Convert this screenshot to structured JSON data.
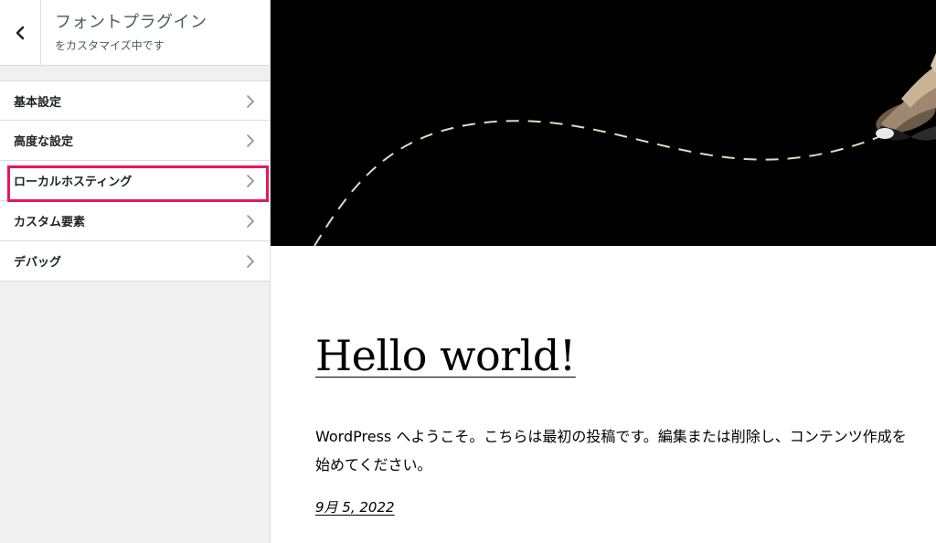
{
  "sidebar": {
    "header": {
      "title": "フォントプラグイン",
      "subtitle": "をカスタマイズ中です"
    },
    "items": [
      {
        "label": "基本設定"
      },
      {
        "label": "高度な設定"
      },
      {
        "label": "ローカルホスティング",
        "highlighted": true
      },
      {
        "label": "カスタム要素"
      },
      {
        "label": "デバッグ"
      }
    ]
  },
  "preview": {
    "post_title": "Hello world!",
    "post_body": "WordPress へようこそ。こちらは最初の投稿です。編集または削除し、コンテンツ作成を始めてください。",
    "post_date": "9月 5, 2022"
  },
  "colors": {
    "highlight": "#e6175c",
    "hero_background": "#000000",
    "dash_line": "#e8d8c0"
  },
  "icons": [
    "chevron-left-icon",
    "chevron-right-icon",
    "bird-illustration"
  ]
}
